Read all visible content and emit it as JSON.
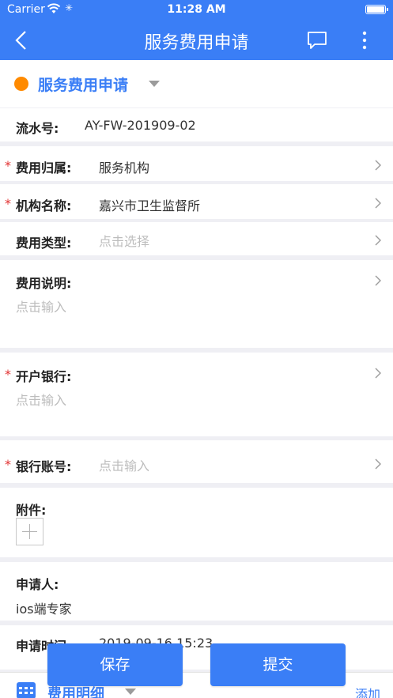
{
  "status": {
    "carrier": "Carrier",
    "time": "11:28 AM"
  },
  "nav": {
    "title": "服务费用申请"
  },
  "section": {
    "title": "服务费用申请"
  },
  "form": {
    "serial": {
      "label": "流水号:",
      "value": "AY-FW-201909-02"
    },
    "belong": {
      "required": "*",
      "label": "费用归属:",
      "value": "服务机构"
    },
    "org": {
      "required": "*",
      "label": "机构名称:",
      "value": "嘉兴市卫生监督所"
    },
    "type": {
      "label": "费用类型:",
      "placeholder": "点击选择"
    },
    "desc": {
      "label": "费用说明:",
      "placeholder": "点击输入"
    },
    "bank": {
      "required": "*",
      "label": "开户银行:",
      "placeholder": "点击输入"
    },
    "account": {
      "required": "*",
      "label": "银行账号:",
      "placeholder": "点击输入"
    },
    "attach": {
      "label": "附件:"
    },
    "applicant": {
      "label": "申请人:",
      "value": "ios端专家"
    },
    "apply_time": {
      "label": "申请时间:",
      "value": "2019-09-16 15:23"
    }
  },
  "detail": {
    "title": "费用明细",
    "add_label": "添加"
  },
  "buttons": {
    "save": "保存",
    "submit": "提交"
  },
  "colors": {
    "primary": "#3a7ef6",
    "dot": "#ff8a00",
    "required": "#e23232"
  }
}
